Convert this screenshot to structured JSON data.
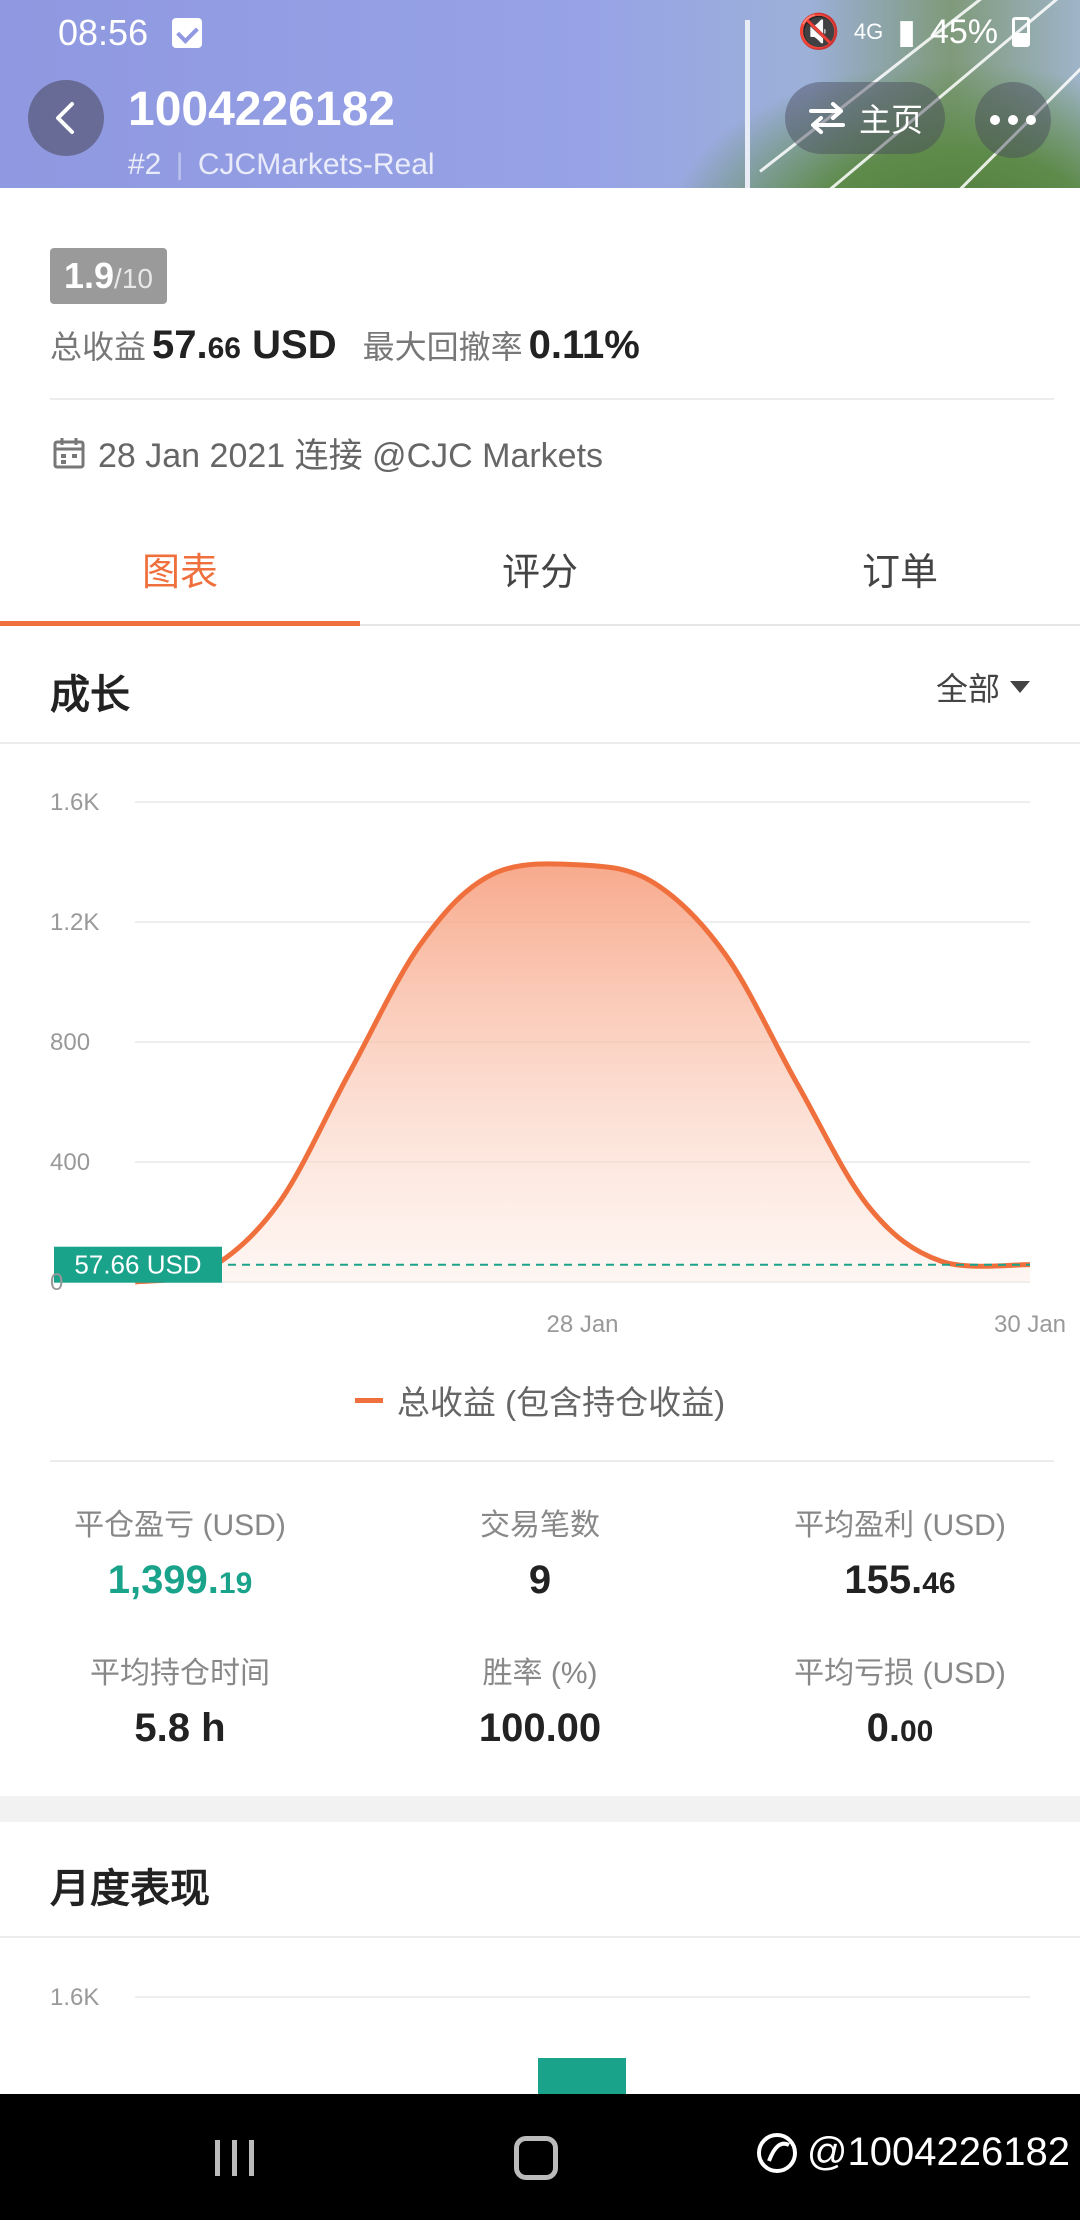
{
  "status_bar": {
    "time": "08:56",
    "network": "4G",
    "battery": "45%"
  },
  "header": {
    "account_id": "1004226182",
    "server_rank": "#2",
    "server_name": "CJCMarkets-Real",
    "home_label": "主页"
  },
  "summary": {
    "rating": "1.9",
    "rating_max": "/10",
    "total_profit_label": "总收益",
    "total_profit_int": "57.",
    "total_profit_dec": "66",
    "total_profit_unit": "USD",
    "max_drawdown_label": "最大回撤率",
    "max_drawdown_value": "0.11%",
    "connection_text": "28 Jan 2021 连接 @CJC Markets"
  },
  "tabs": [
    {
      "label": "图表",
      "active": true
    },
    {
      "label": "评分",
      "active": false
    },
    {
      "label": "订单",
      "active": false
    }
  ],
  "growth": {
    "title": "成长",
    "filter": "全部",
    "marker_label": "57.66 USD",
    "legend": "总收益 (包含持仓收益)"
  },
  "chart_data": {
    "type": "area",
    "title": "",
    "xlabel": "",
    "ylabel": "",
    "ylim": [
      0,
      1600
    ],
    "yticks": [
      "0",
      "400",
      "800",
      "1.2K",
      "1.6K"
    ],
    "xticks": [
      {
        "label": "28 Jan",
        "pos": 0.5
      },
      {
        "label": "30 Jan",
        "pos": 1.0
      }
    ],
    "series": [
      {
        "name": "总收益 (包含持仓收益)",
        "x": [
          0.0,
          0.08,
          0.16,
          0.24,
          0.32,
          0.4,
          0.5,
          0.58,
          0.66,
          0.74,
          0.82,
          0.9,
          1.0
        ],
        "values": [
          0,
          40,
          260,
          700,
          1130,
          1360,
          1390,
          1330,
          1090,
          660,
          250,
          70,
          57.66
        ]
      }
    ],
    "reference_line": 57.66,
    "colors": {
      "line": "#f0703d",
      "fill": "#f7a586",
      "reference": "#1aa38b"
    }
  },
  "stats": {
    "closed_pnl_label": "平仓盈亏 (USD)",
    "closed_pnl_int": "1,399.",
    "closed_pnl_dec": "19",
    "trades_label": "交易笔数",
    "trades_value": "9",
    "avg_profit_label": "平均盈利 (USD)",
    "avg_profit_int": "155.",
    "avg_profit_dec": "46",
    "avg_hold_label": "平均持仓时间",
    "avg_hold_value": "5.8 h",
    "win_rate_label": "胜率 (%)",
    "win_rate_value": "100.00",
    "avg_loss_label": "平均亏损 (USD)",
    "avg_loss_int": "0.",
    "avg_loss_dec": "00"
  },
  "monthly": {
    "title": "月度表现",
    "ytick_top": "1.6K"
  },
  "watermark": "@1004226182",
  "colors": {
    "accent": "#f0703d",
    "green": "#1aa38b"
  }
}
